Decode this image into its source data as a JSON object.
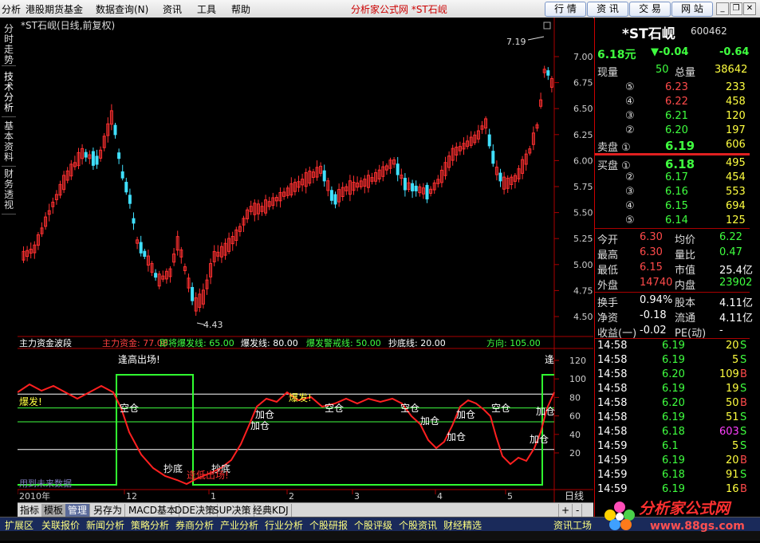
{
  "menu": {
    "items": [
      "分析",
      "港股期货基金",
      "数据查询(N)",
      "资讯",
      "工具",
      "帮助"
    ],
    "center_title": "分析家公式网 *ST石岘",
    "buttons": [
      "行 情",
      "资 讯",
      "交 易",
      "网 站"
    ]
  },
  "left_tabs": [
    "分时走势",
    "技术分析",
    "基本资料",
    "财务透视"
  ],
  "chart": {
    "title": "*ST石岘(日线,前复权)",
    "max_label": "7.19",
    "min_label": "4.43",
    "price_ticks": [
      "7.00",
      "6.75",
      "6.50",
      "6.25",
      "6.00",
      "5.75",
      "5.50",
      "5.25",
      "5.00",
      "4.75",
      "4.50"
    ],
    "indicator_header": {
      "name": "主力资金波段",
      "zljj_label": "主力资金: 77.08",
      "jjbf_label": "即将爆发线: 65.00",
      "bf_label": "爆发线: 80.00",
      "bfjj_label": "爆发警戒线: 50.00",
      "cd_label": "抄底线: 20.00",
      "fx_label": "方向: 105.00"
    },
    "indicator_ticks": [
      "120",
      "100",
      "80",
      "60",
      "40",
      "20"
    ],
    "annotations": {
      "top_exit": "逢高出场!",
      "top_exit_right": "逢",
      "burst": "爆发!",
      "empty": "空仓",
      "add": "加仓",
      "bottom": "抄底",
      "bottom_exit": "逢低出场!",
      "footer_text": "用到未来数据"
    },
    "date_labels": [
      "2010年",
      "12",
      "1",
      "2",
      "3",
      "4",
      "5"
    ],
    "period_label": "日线",
    "colors": {
      "up": "#ff3030",
      "down": "#40e0ff",
      "green_line": "#30ff30",
      "red_line": "#ff2020"
    }
  },
  "bottom_tabs": [
    "指标",
    "模板",
    "管理",
    "另存为",
    "MACD基本",
    "DDE决策",
    "SUP决策",
    "经典KDJ"
  ],
  "bottom_tab_controls": [
    "+",
    "-"
  ],
  "bottom_bar": [
    "扩展区",
    "关联报价",
    "新闻分析",
    "策略分析",
    "券商分析",
    "产业分析",
    "行业分析",
    "个股研报",
    "个股评级",
    "个股资讯",
    "财经精选",
    "资讯工场"
  ],
  "quote": {
    "name": "*ST石岘",
    "code": "600462",
    "price": "6.18元",
    "change": "▼-0.04",
    "change_pct": "-0.64",
    "xianliang_label": "现量",
    "xianliang": "50",
    "zongliang_label": "总量",
    "zongliang": "38642",
    "sell": [
      {
        "lvl": "⑤",
        "price": "6.23",
        "vol": "233"
      },
      {
        "lvl": "④",
        "price": "6.22",
        "vol": "458"
      },
      {
        "lvl": "③",
        "price": "6.21",
        "vol": "120"
      },
      {
        "lvl": "②",
        "price": "6.20",
        "vol": "197"
      },
      {
        "lvl": "卖盘 ①",
        "price": "6.19",
        "vol": "606"
      }
    ],
    "buy": [
      {
        "lvl": "买盘 ①",
        "price": "6.18",
        "vol": "495"
      },
      {
        "lvl": "②",
        "price": "6.17",
        "vol": "454"
      },
      {
        "lvl": "③",
        "price": "6.16",
        "vol": "553"
      },
      {
        "lvl": "④",
        "price": "6.15",
        "vol": "694"
      },
      {
        "lvl": "⑤",
        "price": "6.14",
        "vol": "125"
      }
    ],
    "stats": [
      {
        "l1": "今开",
        "v1": "6.30",
        "l2": "均价",
        "v2": "6.22"
      },
      {
        "l1": "最高",
        "v1": "6.30",
        "l2": "量比",
        "v2": "0.47"
      },
      {
        "l1": "最低",
        "v1": "6.15",
        "l2": "市值",
        "v2": "25.4亿"
      },
      {
        "l1": "外盘",
        "v1": "14740",
        "l2": "内盘",
        "v2": "23902"
      }
    ],
    "stats2": [
      {
        "l1": "换手",
        "v1": "0.94%",
        "l2": "股本",
        "v2": "4.11亿"
      },
      {
        "l1": "净资",
        "v1": "-0.18",
        "l2": "流通",
        "v2": "4.11亿"
      },
      {
        "l1": "收益(一)",
        "v1": "-0.02",
        "l2": "PE(动)",
        "v2": "-"
      }
    ],
    "ticks": [
      {
        "t": "14:58",
        "p": "6.19",
        "v": "20",
        "d": "S"
      },
      {
        "t": "14:58",
        "p": "6.19",
        "v": "5",
        "d": "S"
      },
      {
        "t": "14:58",
        "p": "6.20",
        "v": "109",
        "d": "B"
      },
      {
        "t": "14:58",
        "p": "6.19",
        "v": "19",
        "d": "S"
      },
      {
        "t": "14:58",
        "p": "6.20",
        "v": "50",
        "d": "B"
      },
      {
        "t": "14:58",
        "p": "6.19",
        "v": "51",
        "d": "S"
      },
      {
        "t": "14:58",
        "p": "6.18",
        "v": "603",
        "d": "S"
      },
      {
        "t": "14:59",
        "p": "6.1",
        "v": "5",
        "d": "S"
      },
      {
        "t": "14:59",
        "p": "6.19",
        "v": "20",
        "d": "B"
      },
      {
        "t": "14:59",
        "p": "6.18",
        "v": "91",
        "d": "S"
      },
      {
        "t": "14:59",
        "p": "6.19",
        "v": "16",
        "d": "B"
      }
    ]
  },
  "logo": {
    "name": "分析家公式网",
    "url": "www.88gs.com"
  }
}
